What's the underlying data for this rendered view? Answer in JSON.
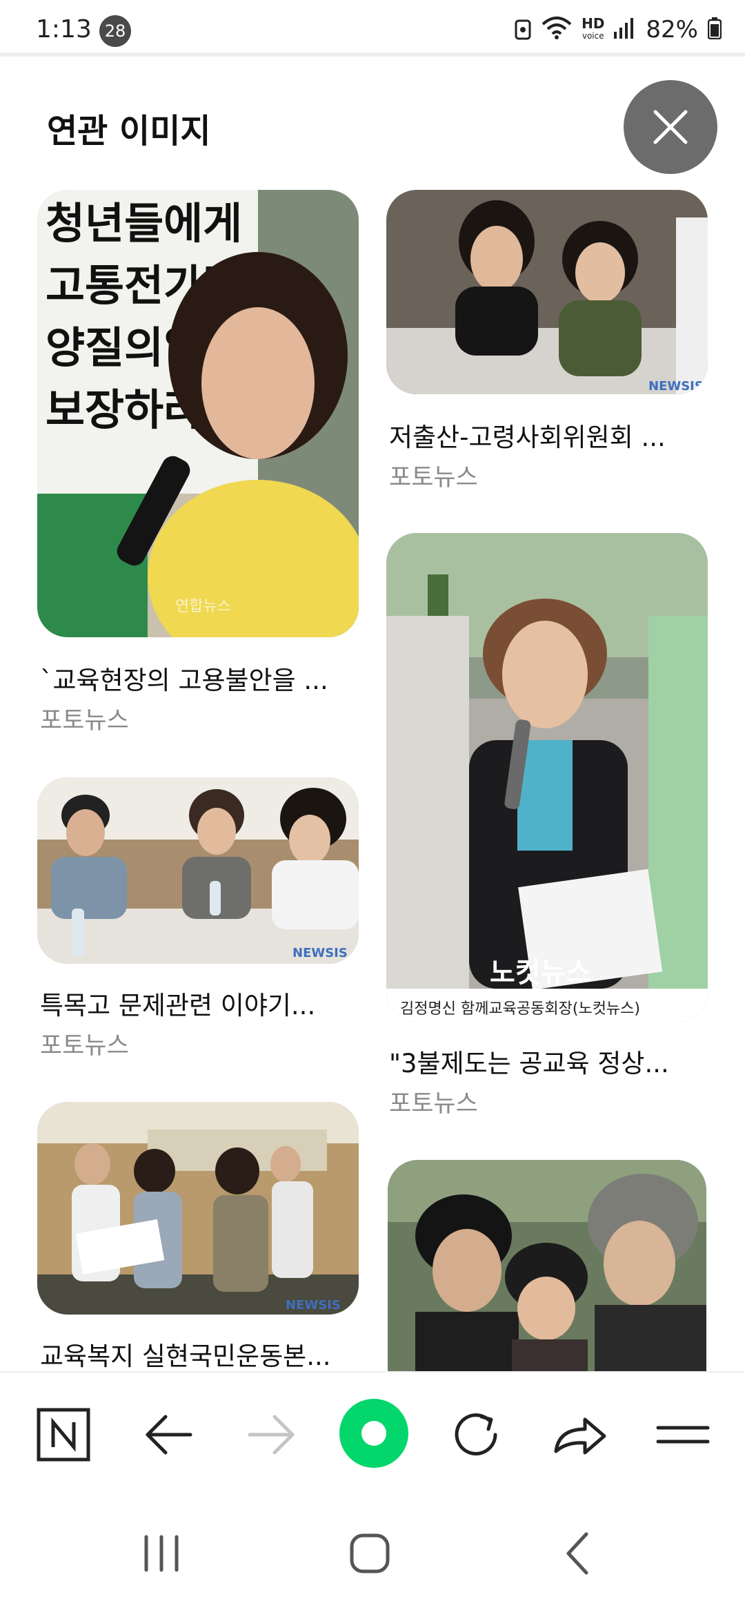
{
  "status_bar": {
    "time": "1:13",
    "badge": "28",
    "hd_top": "HD",
    "hd_bottom": "voice",
    "battery": "82%"
  },
  "header": {
    "title": "연관 이미지"
  },
  "cards": [
    {
      "title": "`교육현장의 고용불안을 ...",
      "source": "포토뉴스",
      "image_text": [
        "청년들에게",
        "고통전가말고",
        "양질의일자",
        "보장하라!"
      ],
      "watermark": "연합뉴스"
    },
    {
      "title": "저출산-고령사회위원회 ...",
      "source": "포토뉴스",
      "watermark": "NEWSIS"
    },
    {
      "title": "특목고 문제관련 이야기...",
      "source": "포토뉴스",
      "watermark": "NEWSIS"
    },
    {
      "title": "\"3불제도는 공교육 정상...",
      "source": "포토뉴스",
      "watermark": "노컷뉴스",
      "watermark_url": "nocutnews.co.kr",
      "caption": "김정명신 함께교육공동회장(노컷뉴스)"
    },
    {
      "title": "교육복지 실현국민운동본...",
      "source": "",
      "watermark": "NEWSIS"
    },
    {
      "title": "",
      "source": ""
    }
  ],
  "toolbar": {
    "icons": [
      "naver-home-icon",
      "back-arrow-icon",
      "forward-arrow-icon",
      "green-dot-icon",
      "refresh-icon",
      "share-icon",
      "menu-icon"
    ],
    "accent": "#03d66a"
  },
  "navbar": {
    "icons": [
      "recents-icon",
      "home-icon",
      "back-icon"
    ]
  }
}
